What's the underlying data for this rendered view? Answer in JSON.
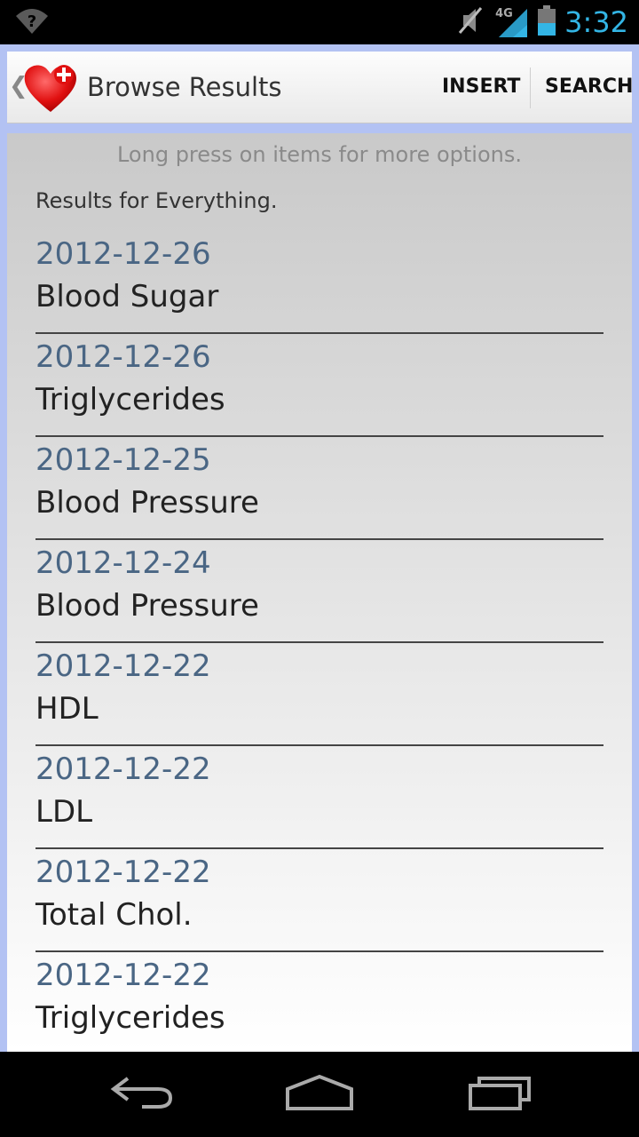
{
  "status_bar": {
    "network_label": "4G",
    "clock": "3:32"
  },
  "action_bar": {
    "title": "Browse Results",
    "insert_label": "INSERT",
    "search_label": "SEARCH"
  },
  "content": {
    "hint": "Long press on items for more options.",
    "scope": "Results for Everything.",
    "items": [
      {
        "date": "2012-12-26",
        "name": "Blood Sugar"
      },
      {
        "date": "2012-12-26",
        "name": "Triglycerides"
      },
      {
        "date": "2012-12-25",
        "name": "Blood Pressure"
      },
      {
        "date": "2012-12-24",
        "name": "Blood Pressure"
      },
      {
        "date": "2012-12-22",
        "name": "HDL"
      },
      {
        "date": "2012-12-22",
        "name": "LDL"
      },
      {
        "date": "2012-12-22",
        "name": "Total Chol."
      },
      {
        "date": "2012-12-22",
        "name": "Triglycerides"
      }
    ]
  },
  "colors": {
    "accent": "#33b5e5",
    "date_text": "#4a6684",
    "frame": "#b3c2f3"
  }
}
